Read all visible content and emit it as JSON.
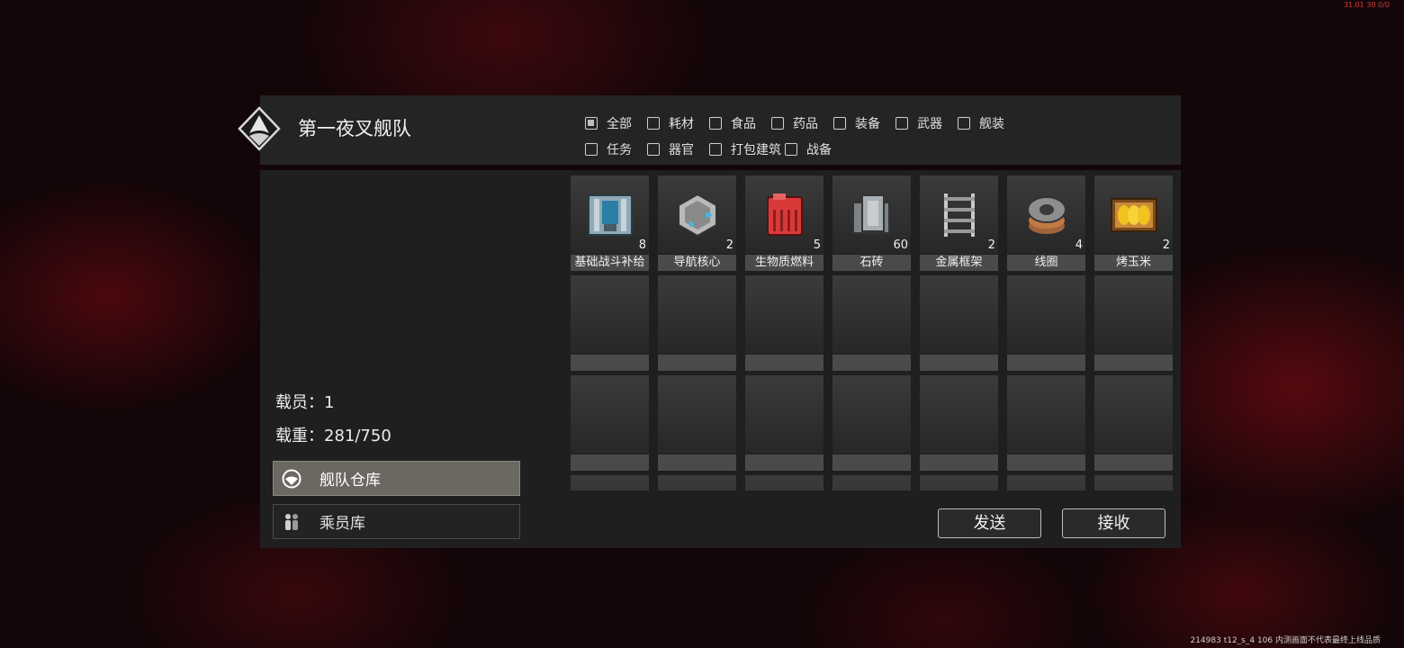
{
  "overlay": {
    "top_right_debug": "31.01 30 0/0",
    "bottom_right_watermark": "214983 t12_s_4 106 内测画面不代表最终上线品质"
  },
  "header": {
    "fleet_name": "第一夜叉舰队",
    "filters_row1": [
      {
        "label": "全部",
        "checked": true
      },
      {
        "label": "耗材",
        "checked": false
      },
      {
        "label": "食品",
        "checked": false
      },
      {
        "label": "药品",
        "checked": false
      },
      {
        "label": "装备",
        "checked": false
      },
      {
        "label": "武器",
        "checked": false
      },
      {
        "label": "舰装",
        "checked": false
      }
    ],
    "filters_row2": [
      {
        "label": "任务",
        "checked": false
      },
      {
        "label": "器官",
        "checked": false
      },
      {
        "label": "打包建筑",
        "checked": false
      },
      {
        "label": "战备",
        "checked": false
      }
    ]
  },
  "sidebar": {
    "crew_label": "载员：1",
    "load_label": "载重：281/750",
    "fleet_storage_button": "舰队仓库",
    "crew_storage_button": "乘员库"
  },
  "inventory": {
    "items": [
      {
        "name": "基础战斗补给",
        "count": "8",
        "icon": "supply-crate-icon"
      },
      {
        "name": "导航核心",
        "count": "2",
        "icon": "nav-core-icon"
      },
      {
        "name": "生物质燃料",
        "count": "5",
        "icon": "fuel-canister-icon"
      },
      {
        "name": "石砖",
        "count": "60",
        "icon": "stone-brick-icon"
      },
      {
        "name": "金属框架",
        "count": "2",
        "icon": "metal-frame-icon"
      },
      {
        "name": "线圈",
        "count": "4",
        "icon": "coil-icon"
      },
      {
        "name": "烤玉米",
        "count": "2",
        "icon": "roasted-corn-icon"
      }
    ]
  },
  "actions": {
    "send": "发送",
    "receive": "接收"
  },
  "colors": {
    "background": "#140608",
    "panel": "#242424",
    "accent_red": "#d23a3a"
  }
}
